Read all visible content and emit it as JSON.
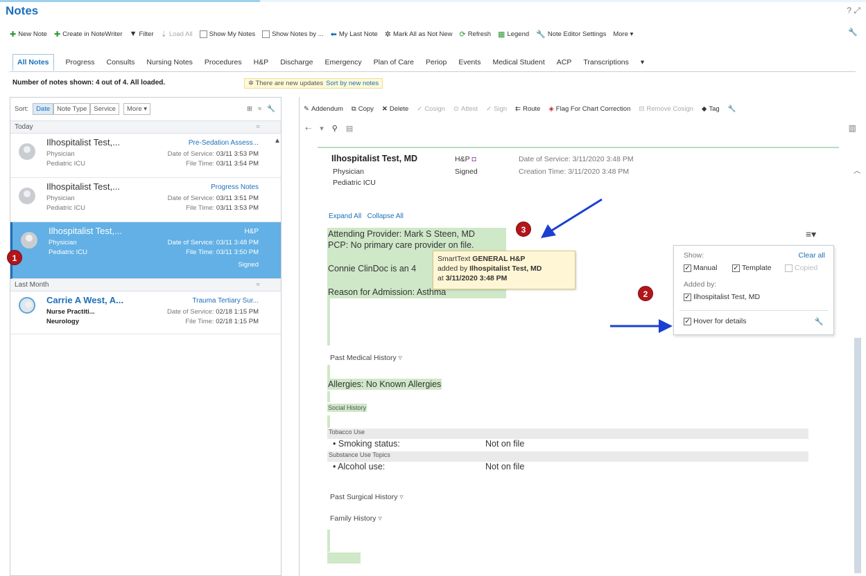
{
  "app": {
    "title": "Notes",
    "help_icon": "?",
    "expand_icon": "⤢"
  },
  "toolbar": {
    "new_note": "New Note",
    "create_in_notewriter": "Create in NoteWriter",
    "filter": "Filter",
    "load_all": "Load All",
    "show_my_notes": "Show My Notes",
    "show_notes_by": "Show Notes by ...",
    "my_last_note": "My Last Note",
    "mark_all_not_new": "Mark All as Not New",
    "refresh": "Refresh",
    "legend": "Legend",
    "note_editor_settings": "Note Editor Settings",
    "more": "More ▾"
  },
  "tabs": [
    {
      "label": "All Notes",
      "active": true
    },
    {
      "label": "Progress"
    },
    {
      "label": "Consults"
    },
    {
      "label": "Nursing Notes"
    },
    {
      "label": "Procedures"
    },
    {
      "label": "H&P"
    },
    {
      "label": "Discharge"
    },
    {
      "label": "Emergency"
    },
    {
      "label": "Plan of Care"
    },
    {
      "label": "Periop"
    },
    {
      "label": "Events"
    },
    {
      "label": "Medical Student"
    },
    {
      "label": "ACP"
    },
    {
      "label": "Transcriptions"
    },
    {
      "label": "▾"
    }
  ],
  "status": {
    "notes_count": "Number of notes shown: 4 out of 4. All loaded.",
    "updates_text": "There are new updates",
    "sort_by_new": "Sort by new notes"
  },
  "left_panel": {
    "sort_label": "Sort:",
    "sort_date": "Date",
    "sort_note_type": "Note Type",
    "sort_service": "Service",
    "more": "More ▾",
    "groups": [
      {
        "label": "Today"
      },
      {
        "label": "Last Month"
      }
    ],
    "notes": [
      {
        "name": "Ilhospitalist Test,...",
        "type": "Pre-Sedation Assess...",
        "role": "Physician",
        "dept": "Pediatric ICU",
        "dos_label": "Date of Service:",
        "dos": "03/11 3:53 PM",
        "ft_label": "File Time:",
        "ft": "03/11 3:54 PM"
      },
      {
        "name": "Ilhospitalist Test,...",
        "type": "Progress Notes",
        "role": "Physician",
        "dept": "Pediatric ICU",
        "dos_label": "Date of Service:",
        "dos": "03/11 3:51 PM",
        "ft_label": "File Time:",
        "ft": "03/11 3:53 PM"
      },
      {
        "name": "Ilhospitalist Test,...",
        "type": "H&P",
        "role": "Physician",
        "dept": "Pediatric ICU",
        "dos_label": "Date of Service:",
        "dos": "03/11 3:48 PM",
        "ft_label": "File Time:",
        "ft": "03/11 3:50 PM",
        "status": "Signed"
      },
      {
        "name": "Carrie A West, A...",
        "type": "Trauma Tertiary Sur...",
        "role": "Nurse Practiti...",
        "dept": "Neurology",
        "dos_label": "Date of Service:",
        "dos": "02/18 1:15 PM",
        "ft_label": "File Time:",
        "ft": "02/18 1:15 PM"
      }
    ]
  },
  "right_toolbar": {
    "addendum": "Addendum",
    "copy": "Copy",
    "delete": "Delete",
    "cosign": "Cosign",
    "attest": "Attest",
    "sign": "Sign",
    "route": "Route",
    "flag": "Flag For Chart Correction",
    "remove_cosign": "Remove Cosign",
    "tag": "Tag"
  },
  "document": {
    "author": "Ilhospitalist Test, MD",
    "role": "Physician",
    "dept": "Pediatric ICU",
    "note_type": "H&P",
    "status": "Signed",
    "dos_label": "Date of Service:",
    "dos": "3/11/2020 3:48 PM",
    "created_label": "Creation Time:",
    "created": "3/11/2020 3:48 PM",
    "expand_all": "Expand All",
    "collapse_all": "Collapse All",
    "line1": "Attending Provider: Mark S Steen, MD",
    "line2": "PCP: No primary care provider on file.",
    "line3": "Connie ClinDoc is an 4",
    "line4": "Reason for Admission:  Asthma",
    "past_medical_history": "Past Medical History",
    "allergies": "Allergies: No Known Allergies",
    "social_history": "Social History",
    "tobacco_use": "Tobacco Use",
    "smoking_status": "Smoking status:",
    "smoking_value": "Not on file",
    "substance_use": "Substance Use Topics",
    "alcohol_use": "Alcohol use:",
    "alcohol_value": "Not on file",
    "past_surgical_history": "Past Surgical History",
    "family_history": "Family History"
  },
  "tooltip": {
    "line1_pre": "SmartText",
    "line1_bold": "GENERAL H&P",
    "line2_pre": "added by",
    "line2_bold": "Ilhospitalist Test, MD",
    "line3_pre": "at",
    "line3_bold": "3/11/2020 3:48 PM"
  },
  "filter_box": {
    "show_label": "Show:",
    "clear_all": "Clear all",
    "manual": "Manual",
    "template": "Template",
    "copied": "Copied",
    "added_by_label": "Added by:",
    "author": "Ilhospitalist Test, MD",
    "hover_details": "Hover for details"
  },
  "callouts": {
    "one": "1",
    "two": "2",
    "three": "3"
  },
  "colors": {
    "accent": "#1d6fb8",
    "selected_row": "#62b0e5",
    "highlight": "#cfe8c8",
    "callout": "#b3151b",
    "tooltip_bg": "#fff6d6",
    "arrow": "#1b3fd1"
  }
}
